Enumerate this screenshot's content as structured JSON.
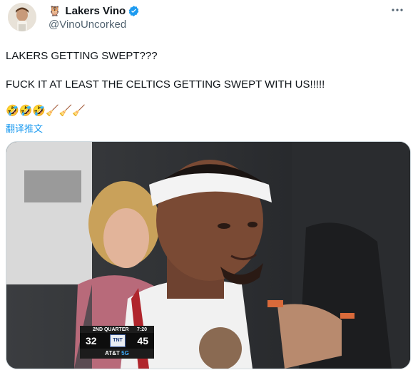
{
  "author": {
    "display_name": "Lakers Vino",
    "handle": "@VinoUncorked",
    "owl_glyph": "🦉",
    "verified_color": "#1d9bf0"
  },
  "tweet": {
    "line1": "LAKERS GETTING SWEPT???",
    "line2": "FUCK IT AT LEAST THE CELTICS GETTING SWEPT WITH US!!!!!",
    "emojis": "🤣🤣🤣🧹🧹🧹",
    "translate_label": "翻译推文"
  },
  "scorebug": {
    "quarter": "2ND QUARTER",
    "clock": "7:20",
    "score_left": "32",
    "network": "TNT",
    "score_right": "45",
    "sponsor": "AT&T",
    "sponsor_suffix": "5G"
  },
  "colors": {
    "text_primary": "#0f1419",
    "text_secondary": "#536471",
    "link": "#1d9bf0"
  }
}
